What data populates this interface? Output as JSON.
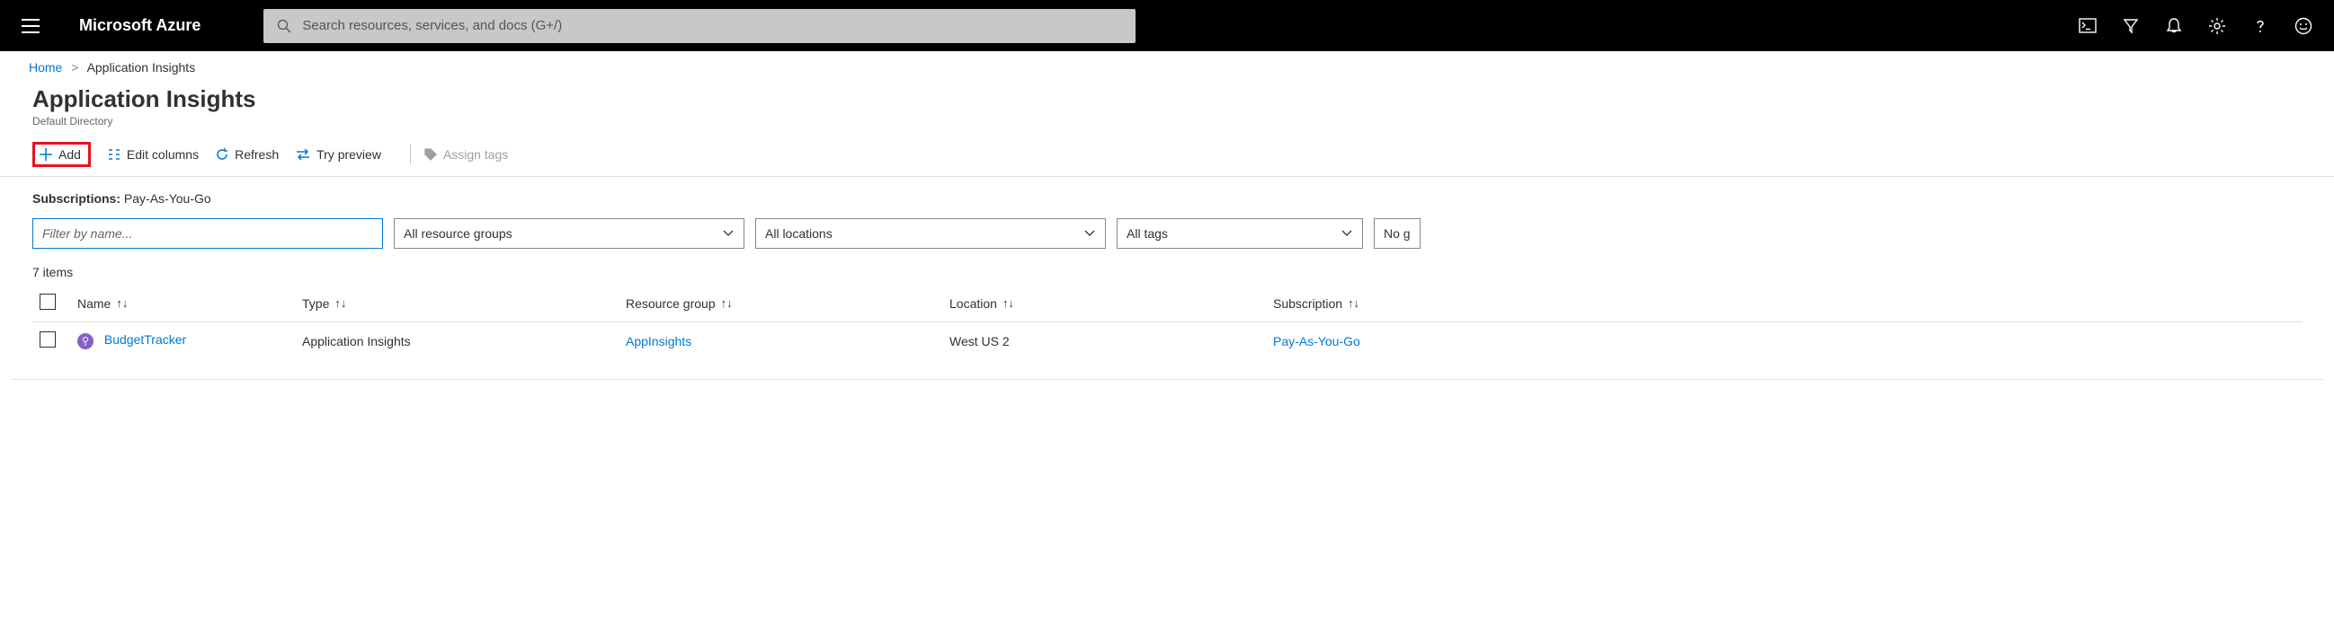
{
  "brand": "Microsoft Azure",
  "search": {
    "placeholder": "Search resources, services, and docs (G+/)"
  },
  "breadcrumb": {
    "home": "Home",
    "sep": ">",
    "current": "Application Insights"
  },
  "header": {
    "title": "Application Insights",
    "subtitle": "Default Directory"
  },
  "toolbar": {
    "add": "Add",
    "edit_columns": "Edit columns",
    "refresh": "Refresh",
    "try_preview": "Try preview",
    "assign_tags": "Assign tags"
  },
  "subscriptions": {
    "label": "Subscriptions:",
    "value": "Pay-As-You-Go"
  },
  "filters": {
    "name_placeholder": "Filter by name...",
    "resource_groups": "All resource groups",
    "locations": "All locations",
    "tags": "All tags",
    "no_grouping": "No g"
  },
  "table": {
    "count_label": "7 items",
    "columns": {
      "name": "Name",
      "type": "Type",
      "resource_group": "Resource group",
      "location": "Location",
      "subscription": "Subscription"
    },
    "sort_glyph": "↑↓",
    "rows": [
      {
        "name": "BudgetTracker",
        "type": "Application Insights",
        "resource_group": "AppInsights",
        "location": "West US 2",
        "subscription": "Pay-As-You-Go"
      }
    ]
  }
}
